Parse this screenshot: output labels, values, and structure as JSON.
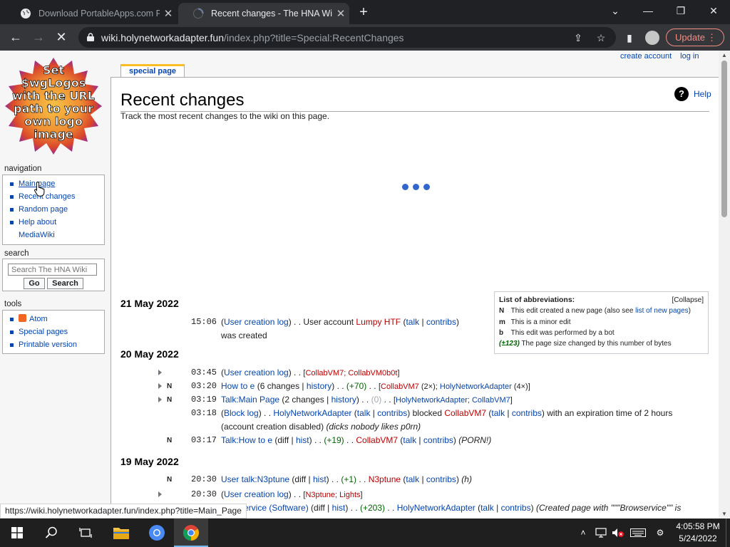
{
  "browser": {
    "tabs": [
      {
        "title": "Download PortableApps.com Pla",
        "active": false
      },
      {
        "title": "Recent changes - The HNA Wiki",
        "active": true
      }
    ],
    "url_host": "wiki.holynetworkadapter.fun",
    "url_path": "/index.php?title=Special:RecentChanges",
    "update_label": "Update",
    "status_url": "https://wiki.holynetworkadapter.fun/index.php?title=Main_Page"
  },
  "wiki": {
    "logo_text": "Set $wgLogos with the URL path to your own logo image",
    "personal": {
      "create_account": "create account",
      "log_in": "log in"
    },
    "content_tab": "special page",
    "title": "Recent changes",
    "help": "Help",
    "intro": "Track the most recent changes to the wiki on this page.",
    "navigation": {
      "heading": "navigation",
      "items": [
        "Main page",
        "Recent changes",
        "Random page",
        "Help about",
        "MediaWiki"
      ]
    },
    "search": {
      "heading": "search",
      "placeholder": "Search The HNA Wiki",
      "go": "Go",
      "search": "Search"
    },
    "tools": {
      "heading": "tools",
      "items": [
        "Atom",
        "Special pages",
        "Printable version"
      ]
    },
    "legend": {
      "title": "List of abbreviations:",
      "collapse": "[Collapse]",
      "n_key": "N",
      "n_text": "This edit created a new page (also see ",
      "n_link": "list of new pages",
      "n_end": ")",
      "m_key": "m",
      "m_text": "This is a minor edit",
      "b_key": "b",
      "b_text": "This edit was performed by a bot",
      "size_key": "(±123)",
      "size_text": "The page size changed by this number of bytes"
    },
    "dates": [
      "21 May 2022",
      "20 May 2022",
      "19 May 2022"
    ],
    "changes": {
      "c1": {
        "time": "15:06",
        "log": "User creation log",
        "sep": ") . . User account ",
        "user": "Lumpy HTF",
        "talk": "talk",
        "contribs": "contribs",
        "end": "was created"
      },
      "c2": {
        "time": "03:45",
        "log": "User creation log",
        "users": "CollabVM7; CollabVM0b0t"
      },
      "c3": {
        "time": "03:20",
        "flag": "N",
        "page": "How to e",
        "count": "6 changes",
        "history": "history",
        "diff": "(+70)",
        "u1": "CollabVM7",
        "u1c": "(2×)",
        "u2": "HolyNetworkAdapter",
        "u2c": "(4×)"
      },
      "c4": {
        "time": "03:19",
        "flag": "N",
        "page": "Talk:Main Page",
        "count": "2 changes",
        "history": "history",
        "diff": "(0)",
        "users": "HolyNetworkAdapter; CollabVM7"
      },
      "c5": {
        "time": "03:18",
        "log": "Block log",
        "user": "HolyNetworkAdapter",
        "talk": "talk",
        "contribs": "contribs",
        "verb": "blocked",
        "target": "CollabVM7",
        "rest": "with an expiration time of 2 hours",
        "line2": "(account creation disabled)",
        "reason": "(dicks nobody likes p0rn)"
      },
      "c6": {
        "time": "03:17",
        "flag": "N",
        "page": "Talk:How to e",
        "diff_word": "diff",
        "hist": "hist",
        "size": "(+19)",
        "user": "CollabVM7",
        "talk": "talk",
        "contribs": "contribs",
        "comment": "(PORN!)"
      },
      "c7": {
        "time": "20:30",
        "flag": "N",
        "page": "User talk:N3ptune",
        "diff_word": "diff",
        "hist": "hist",
        "size": "(+1)",
        "user": "N3ptune",
        "talk": "talk",
        "contribs": "contribs",
        "comment": "(h)"
      },
      "c8": {
        "time": "20:30",
        "log": "User creation log",
        "users": "N3ptune; Lights"
      },
      "c9": {
        "page": "ervice (Software)",
        "diff_word": "diff",
        "hist": "hist",
        "size": "(+203)",
        "user": "HolyNetworkAdapter",
        "talk": "talk",
        "contribs": "contribs",
        "comment": "(Created page with \"\"\"Browservice\"\" is"
      }
    }
  },
  "taskbar": {
    "time": "4:05:58 PM",
    "date": "5/24/2022"
  }
}
